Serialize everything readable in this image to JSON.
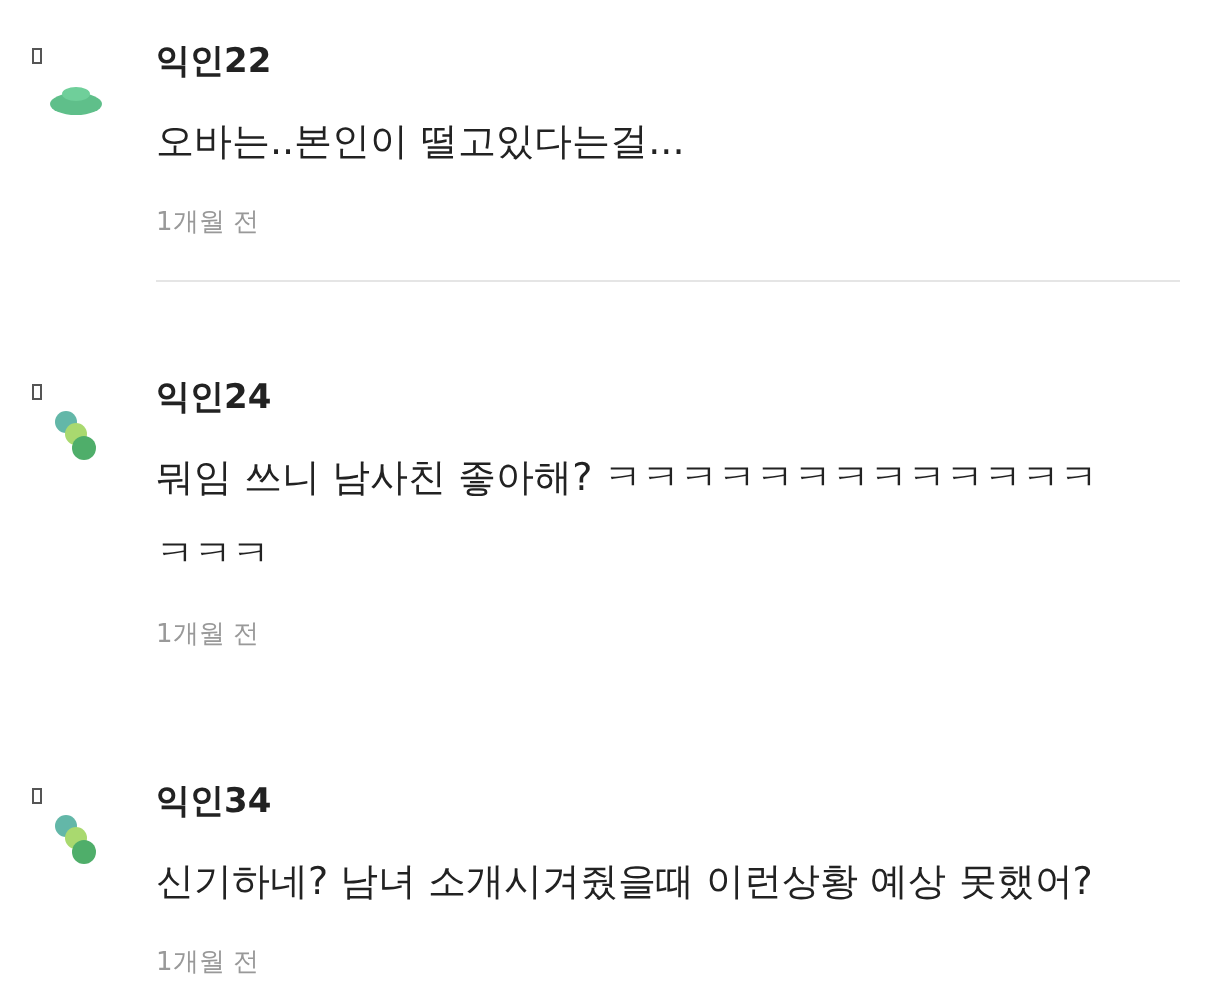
{
  "comments": [
    {
      "kind": "disc",
      "author": "익인22",
      "body": "오바는..본인이 떨고있다는걸...",
      "time": "1개월 전",
      "divided": true
    },
    {
      "kind": "dots",
      "author": "익인24",
      "body": "뭐임 쓰니 남사친 좋아해? ㅋㅋㅋㅋㅋㅋㅋㅋㅋㅋㅋㅋㅋㅋㅋㅋ",
      "time": "1개월 전",
      "divided": false
    },
    {
      "kind": "dots",
      "author": "익인34",
      "body": "신기하네? 남녀 소개시겨줬을때 이런상황 예상 못했어?",
      "time": "1개월 전"
    }
  ]
}
